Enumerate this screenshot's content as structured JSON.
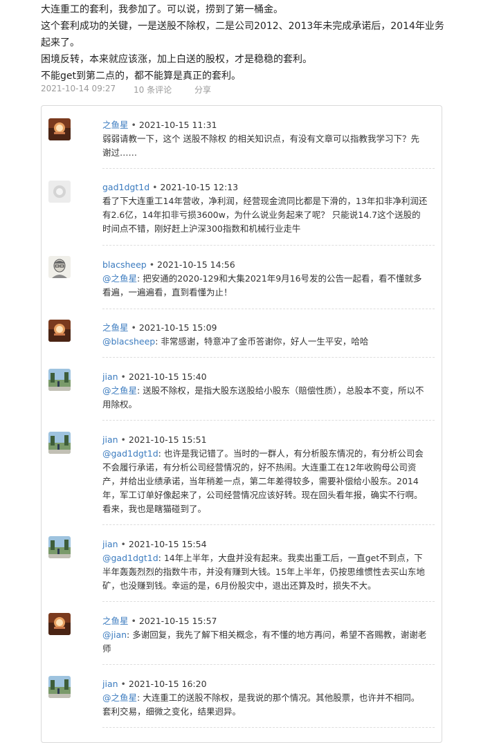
{
  "post": {
    "lines": [
      "大连重工的套利，我参加了。可以说，捞到了第一桶金。",
      "这个套利成功的关键，一是送股不除权，二是公司2012、2013年未完成承诺后，2014年业务起来了。",
      "困境反转，本来就应该涨，加上白送的股权，才是稳稳的套利。",
      "不能get到第二点的，都不能算是真正的套利。"
    ],
    "date": "2021-10-14 09:27",
    "comments_label": "10 条评论",
    "share_label": "分享"
  },
  "comments": [
    {
      "author": "之鱼星",
      "time": "2021-10-15 11:31",
      "avatar": "sunset-avatar",
      "mention": "",
      "text": "弱弱请教一下，这个 送股不除权 的相关知识点，有没有文章可以指教我学习下？先谢过……"
    },
    {
      "author": "gad1dgt1d",
      "time": "2021-10-15 12:13",
      "avatar": "gray-default-avatar",
      "mention": "",
      "text": "看了下大连重工14年营收，净利润，经营现金流同比都是下滑的，13年扣非净利润还有2.6亿，14年扣非亏损3600w，为什么说业务起来了呢？ 只能说14.7这个送股的时间点不错，刚好赶上沪深300指数和机械行业走牛"
    },
    {
      "author": "blacsheep",
      "time": "2021-10-15 14:56",
      "avatar": "sketch-portrait-avatar",
      "mention": "@之鱼星",
      "text": ": 把安通的2020-129和大集2021年9月16号发的公告一起看，看不懂就多看遍，一遍遍看，直到看懂为止！"
    },
    {
      "author": "之鱼星",
      "time": "2021-10-15 15:09",
      "avatar": "sunset-avatar",
      "mention": "@blacsheep",
      "text": ": 非常感谢，特意冲了金币答谢你，好人一生平安，哈哈"
    },
    {
      "author": "jian",
      "time": "2021-10-15 15:40",
      "avatar": "landscape-avatar",
      "mention": "@之鱼星",
      "text": ": 送股不除权，是指大股东送股给小股东（赔偿性质），总股本不变，所以不用除权。"
    },
    {
      "author": "jian",
      "time": "2021-10-15 15:51",
      "avatar": "landscape-avatar",
      "mention": "@gad1dgt1d",
      "text": ": 也许是我记错了。当时的一群人，有分析股东情况的，有分析公司会不会履行承诺，有分析公司经营情况的，好不热闹。大连重工在12年收购母公司资产，并给出业绩承诺，当年稍差一点，第二年差得较多，需要补偿给小股东。2014年，军工订单好像起来了，公司经营情况应该好转。现在回头看年报，确实不行啊。看来，我也是瞎猫碰到了。"
    },
    {
      "author": "jian",
      "time": "2021-10-15 15:54",
      "avatar": "landscape-avatar",
      "mention": "@gad1dgt1d",
      "text": ": 14年上半年，大盘并没有起来。我卖出重工后，一直get不到点，下半年轰轰烈烈的指数牛市，并没有赚到大钱。15年上半年，仍按思维惯性去买山东地矿，也没赚到钱。幸运的是，6月份股灾中，退出还算及时，损失不大。"
    },
    {
      "author": "之鱼星",
      "time": "2021-10-15 15:57",
      "avatar": "sunset-avatar",
      "mention": "@jian",
      "text": ": 多谢回复，我先了解下相关概念，有不懂的地方再问，希望不吝赐教，谢谢老师"
    },
    {
      "author": "jian",
      "time": "2021-10-15 16:20",
      "avatar": "landscape-avatar",
      "mention": "@之鱼星",
      "text": ": 大连重工的送股不除权，是我说的那个情况。其他股票，也许并不相同。套利交易，细微之变化，结果迥异。"
    }
  ]
}
